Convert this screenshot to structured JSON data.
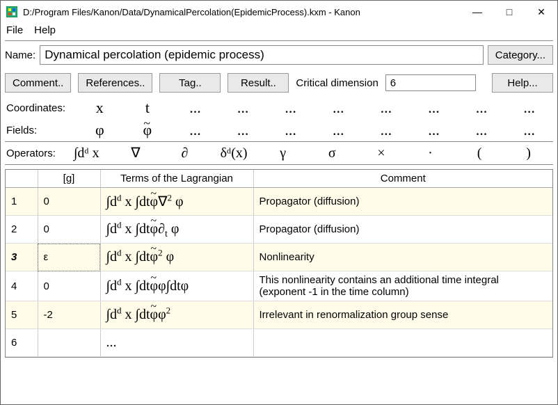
{
  "window": {
    "title": "D:/Program Files/Kanon/Data/DynamicalPercolation(EpidemicProcess).kxm - Kanon"
  },
  "menu": {
    "file": "File",
    "help": "Help"
  },
  "nameRow": {
    "label": "Name:",
    "value": "Dynamical percolation (epidemic process)",
    "category_btn": "Category..."
  },
  "toolbar": {
    "comment": "Comment..",
    "references": "References..",
    "tag": "Tag..",
    "result": "Result..",
    "critdim_label": "Critical dimension",
    "critdim_value": "6",
    "help": "Help..."
  },
  "coords": {
    "label": "Coordinates:",
    "cells": [
      "x",
      "t",
      "...",
      "...",
      "...",
      "...",
      "...",
      "...",
      "...",
      "..."
    ]
  },
  "fields": {
    "label": "Fields:",
    "cells": [
      "φ",
      "φ̃",
      "...",
      "...",
      "...",
      "...",
      "...",
      "...",
      "...",
      "..."
    ]
  },
  "operators": {
    "label": "Operators:",
    "cells": [
      "∫dᵈ x",
      "∇",
      "∂",
      "δᵈ(x)",
      "γ",
      "σ",
      "×",
      "·",
      "(",
      ")"
    ]
  },
  "table": {
    "headers": {
      "idx": "",
      "g": "[g]",
      "terms": "Terms of the Lagrangian",
      "comment": "Comment"
    },
    "rows": [
      {
        "idx": "1",
        "g": "0",
        "term_html": "∫d<sup>d</sup> x ∫dt<span class='tilde-phi'>φ</span>∇<sup>2</sup> φ",
        "comment": "Propagator (diffusion)"
      },
      {
        "idx": "2",
        "g": "0",
        "term_html": "∫d<sup>d</sup> x ∫dt<span class='tilde-phi'>φ</span>∂<sub>t</sub> φ",
        "comment": "Propagator (diffusion)"
      },
      {
        "idx": "3",
        "g": "ε",
        "term_html": "∫d<sup>d</sup> x ∫dt<span class='tilde-phi'>φ</span><sup>2</sup> φ",
        "comment": "Nonlinearity",
        "bold_idx": true,
        "g_dotted": true
      },
      {
        "idx": "4",
        "g": "0",
        "term_html": "∫d<sup>d</sup> x ∫dt<span class='tilde-phi'>φ</span>φ∫dtφ",
        "comment": "This nonlinearity contains an additional time integral (exponent -1 in the time column)"
      },
      {
        "idx": "5",
        "g": "-2",
        "term_html": "∫d<sup>d</sup> x ∫dt<span class='tilde-phi'>φ</span>φ<sup>2</sup>",
        "comment": "Irrelevant in renormalization group sense"
      },
      {
        "idx": "6",
        "g": "",
        "term_html": "...",
        "comment": ""
      }
    ]
  }
}
